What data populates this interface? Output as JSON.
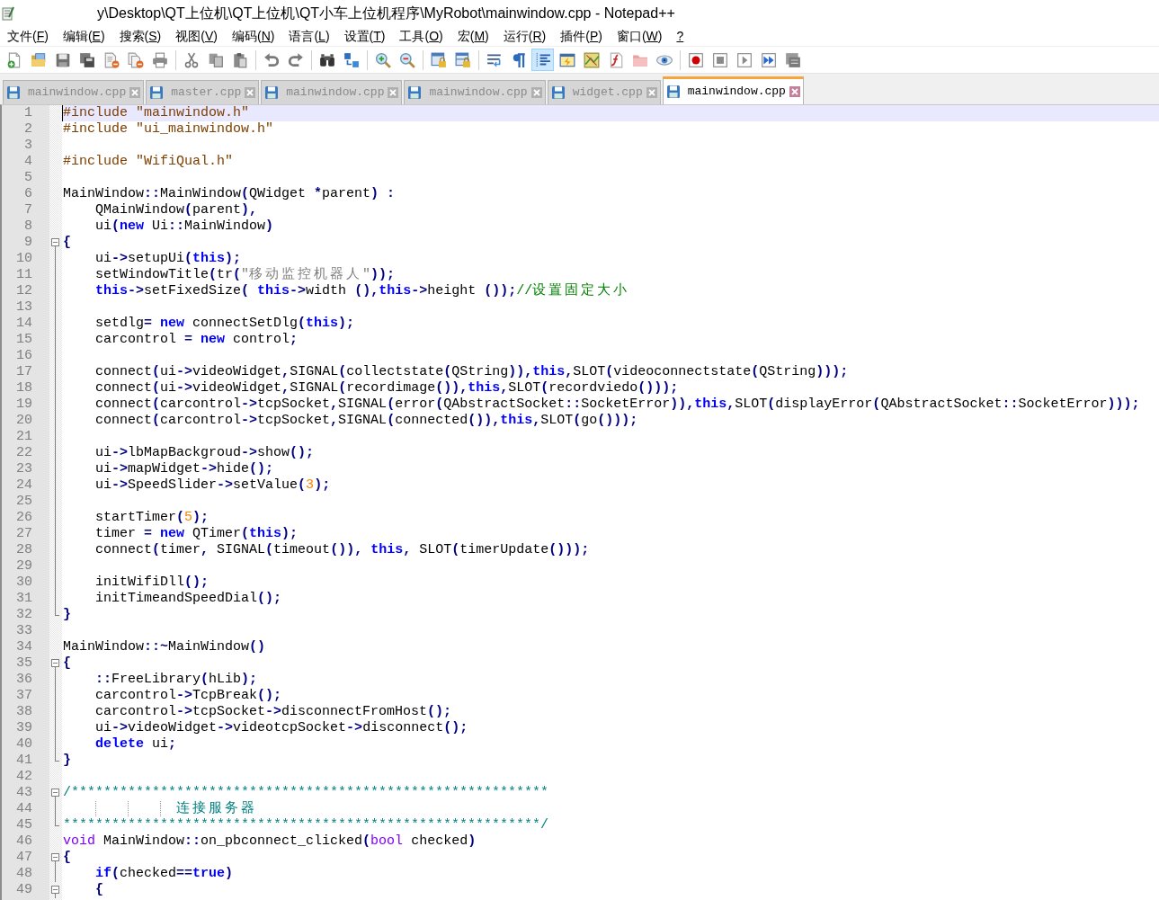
{
  "window": {
    "title": "y\\Desktop\\QT上位机\\QT上位机\\QT小车上位机程序\\MyRobot\\mainwindow.cpp - Notepad++"
  },
  "menu": [
    {
      "label": "文件(F)"
    },
    {
      "label": "编辑(E)"
    },
    {
      "label": "搜索(S)"
    },
    {
      "label": "视图(V)"
    },
    {
      "label": "编码(N)"
    },
    {
      "label": "语言(L)"
    },
    {
      "label": "设置(T)"
    },
    {
      "label": "工具(O)"
    },
    {
      "label": "宏(M)"
    },
    {
      "label": "运行(R)"
    },
    {
      "label": "插件(P)"
    },
    {
      "label": "窗口(W)"
    },
    {
      "label": "?"
    }
  ],
  "toolbar": {
    "groups": [
      {
        "buttons": [
          {
            "kind": "new",
            "on": false
          },
          {
            "kind": "open",
            "on": false
          },
          {
            "kind": "save",
            "on": false
          },
          {
            "kind": "save-all",
            "on": false
          },
          {
            "kind": "close",
            "on": false
          },
          {
            "kind": "close-all",
            "on": false
          },
          {
            "kind": "print",
            "on": false
          }
        ]
      },
      {
        "buttons": [
          {
            "kind": "cut",
            "on": false
          },
          {
            "kind": "copy",
            "on": false
          },
          {
            "kind": "paste",
            "on": false
          }
        ]
      },
      {
        "buttons": [
          {
            "kind": "undo",
            "on": false
          },
          {
            "kind": "redo",
            "on": false
          }
        ]
      },
      {
        "buttons": [
          {
            "kind": "find",
            "on": false
          },
          {
            "kind": "replace",
            "on": false
          }
        ]
      },
      {
        "buttons": [
          {
            "kind": "zoom-in",
            "on": false
          },
          {
            "kind": "zoom-out",
            "on": false
          }
        ]
      },
      {
        "buttons": [
          {
            "kind": "sync-vertical",
            "on": false
          },
          {
            "kind": "sync-horizontal",
            "on": false
          }
        ]
      },
      {
        "buttons": [
          {
            "kind": "word-wrap",
            "on": false
          },
          {
            "kind": "all-chars",
            "on": false
          },
          {
            "kind": "indent-guide",
            "on": true
          },
          {
            "kind": "user-language",
            "on": false
          },
          {
            "kind": "document-map",
            "on": false
          },
          {
            "kind": "function-list",
            "on": false
          },
          {
            "kind": "folder-workspace",
            "on": false
          },
          {
            "kind": "monitoring",
            "on": false
          }
        ]
      },
      {
        "buttons": [
          {
            "kind": "record",
            "on": false
          },
          {
            "kind": "stop",
            "on": false
          },
          {
            "kind": "play",
            "on": false
          },
          {
            "kind": "play-multiple",
            "on": false
          },
          {
            "kind": "save-macro",
            "on": false
          }
        ]
      }
    ]
  },
  "tabs": [
    {
      "label": "mainwindow.cpp",
      "selected": false,
      "modified": false
    },
    {
      "label": "master.cpp",
      "selected": false,
      "modified": false
    },
    {
      "label": "mainwindow.cpp",
      "selected": false,
      "modified": false
    },
    {
      "label": "mainwindow.cpp",
      "selected": false,
      "modified": false
    },
    {
      "label": "widget.cpp",
      "selected": false,
      "modified": false
    },
    {
      "label": "mainwindow.cpp",
      "selected": true,
      "modified": false
    }
  ],
  "editor": {
    "lines": [
      {
        "number": "1",
        "kind": "plain",
        "current": true,
        "segments": [
          {
            "kind": "preprocessor",
            "text": "#include \"mainwindow.h\""
          }
        ]
      },
      {
        "number": "2",
        "kind": "plain",
        "current": false,
        "segments": [
          {
            "kind": "preprocessor",
            "text": "#include \"ui_mainwindow.h\""
          }
        ]
      },
      {
        "number": "3",
        "kind": "plain",
        "current": false
      },
      {
        "number": "4",
        "kind": "plain",
        "current": false,
        "segments": [
          {
            "kind": "preprocessor",
            "text": "#include \"WifiQual.h\""
          }
        ]
      },
      {
        "number": "5",
        "kind": "plain",
        "current": false
      },
      {
        "number": "6",
        "kind": "plain",
        "current": false,
        "segments": [
          {
            "kind": "plain",
            "text": "MainWindow"
          },
          {
            "kind": "op",
            "text": "::"
          },
          {
            "kind": "plain",
            "text": "MainWindow"
          },
          {
            "kind": "op",
            "text": "("
          },
          {
            "kind": "plain",
            "text": "QWidget "
          },
          {
            "kind": "op",
            "text": "*"
          },
          {
            "kind": "plain",
            "text": "parent"
          },
          {
            "kind": "op",
            "text": ") :"
          }
        ]
      },
      {
        "number": "7",
        "kind": "plain",
        "current": false,
        "segments": [
          {
            "kind": "plain",
            "text": "    QMainWindow"
          },
          {
            "kind": "op",
            "text": "("
          },
          {
            "kind": "plain",
            "text": "parent"
          },
          {
            "kind": "op",
            "text": "),"
          }
        ]
      },
      {
        "number": "8",
        "kind": "plain",
        "current": false,
        "segments": [
          {
            "kind": "plain",
            "text": "    ui"
          },
          {
            "kind": "op",
            "text": "("
          },
          {
            "kind": "keyword",
            "text": "new"
          },
          {
            "kind": "plain",
            "text": " Ui"
          },
          {
            "kind": "op",
            "text": "::"
          },
          {
            "kind": "plain",
            "text": "MainWindow"
          },
          {
            "kind": "op",
            "text": ")"
          }
        ]
      },
      {
        "number": "9",
        "kind": "fold-start",
        "current": false,
        "segments": [
          {
            "kind": "op",
            "text": "{"
          }
        ]
      },
      {
        "number": "10",
        "kind": "fold-inside",
        "current": false,
        "segments": [
          {
            "kind": "plain",
            "text": "    ui"
          },
          {
            "kind": "op",
            "text": "->"
          },
          {
            "kind": "plain",
            "text": "setupUi"
          },
          {
            "kind": "op",
            "text": "("
          },
          {
            "kind": "keyword",
            "text": "this"
          },
          {
            "kind": "op",
            "text": ");"
          }
        ]
      },
      {
        "number": "11",
        "kind": "fold-inside",
        "current": false,
        "segments": [
          {
            "kind": "plain",
            "text": "    setWindowTitle"
          },
          {
            "kind": "op",
            "text": "("
          },
          {
            "kind": "plain",
            "text": "tr"
          },
          {
            "kind": "op",
            "text": "("
          },
          {
            "kind": "string",
            "text": "\"移动监控机器人\""
          },
          {
            "kind": "op",
            "text": "));"
          }
        ]
      },
      {
        "number": "12",
        "kind": "fold-inside",
        "current": false,
        "segments": [
          {
            "kind": "keyword",
            "text": "    this"
          },
          {
            "kind": "op",
            "text": "->"
          },
          {
            "kind": "plain",
            "text": "setFixedSize"
          },
          {
            "kind": "op",
            "text": "( "
          },
          {
            "kind": "keyword",
            "text": "this"
          },
          {
            "kind": "op",
            "text": "->"
          },
          {
            "kind": "plain",
            "text": "width "
          },
          {
            "kind": "op",
            "text": "(),"
          },
          {
            "kind": "keyword",
            "text": "this"
          },
          {
            "kind": "op",
            "text": "->"
          },
          {
            "kind": "plain",
            "text": "height "
          },
          {
            "kind": "op",
            "text": "());"
          },
          {
            "kind": "comment",
            "text": "//设置固定大小"
          }
        ]
      },
      {
        "number": "13",
        "kind": "fold-inside",
        "current": false
      },
      {
        "number": "14",
        "kind": "fold-inside",
        "current": false,
        "segments": [
          {
            "kind": "plain",
            "text": "    setdlg"
          },
          {
            "kind": "op",
            "text": "= "
          },
          {
            "kind": "keyword",
            "text": "new"
          },
          {
            "kind": "plain",
            "text": " connectSetDlg"
          },
          {
            "kind": "op",
            "text": "("
          },
          {
            "kind": "keyword",
            "text": "this"
          },
          {
            "kind": "op",
            "text": ");"
          }
        ]
      },
      {
        "number": "15",
        "kind": "fold-inside",
        "current": false,
        "segments": [
          {
            "kind": "plain",
            "text": "    carcontrol "
          },
          {
            "kind": "op",
            "text": "= "
          },
          {
            "kind": "keyword",
            "text": "new"
          },
          {
            "kind": "plain",
            "text": " control"
          },
          {
            "kind": "op",
            "text": ";"
          }
        ]
      },
      {
        "number": "16",
        "kind": "fold-inside",
        "current": false
      },
      {
        "number": "17",
        "kind": "fold-inside",
        "current": false,
        "segments": [
          {
            "kind": "plain",
            "text": "    connect"
          },
          {
            "kind": "op",
            "text": "("
          },
          {
            "kind": "plain",
            "text": "ui"
          },
          {
            "kind": "op",
            "text": "->"
          },
          {
            "kind": "plain",
            "text": "videoWidget"
          },
          {
            "kind": "op",
            "text": ","
          },
          {
            "kind": "plain",
            "text": "SIGNAL"
          },
          {
            "kind": "op",
            "text": "("
          },
          {
            "kind": "plain",
            "text": "collectstate"
          },
          {
            "kind": "op",
            "text": "("
          },
          {
            "kind": "plain",
            "text": "QString"
          },
          {
            "kind": "op",
            "text": ")),"
          },
          {
            "kind": "keyword",
            "text": "this"
          },
          {
            "kind": "op",
            "text": ","
          },
          {
            "kind": "plain",
            "text": "SLOT"
          },
          {
            "kind": "op",
            "text": "("
          },
          {
            "kind": "plain",
            "text": "videoconnectstate"
          },
          {
            "kind": "op",
            "text": "("
          },
          {
            "kind": "plain",
            "text": "QString"
          },
          {
            "kind": "op",
            "text": ")));"
          }
        ]
      },
      {
        "number": "18",
        "kind": "fold-inside",
        "current": false,
        "segments": [
          {
            "kind": "plain",
            "text": "    connect"
          },
          {
            "kind": "op",
            "text": "("
          },
          {
            "kind": "plain",
            "text": "ui"
          },
          {
            "kind": "op",
            "text": "->"
          },
          {
            "kind": "plain",
            "text": "videoWidget"
          },
          {
            "kind": "op",
            "text": ","
          },
          {
            "kind": "plain",
            "text": "SIGNAL"
          },
          {
            "kind": "op",
            "text": "("
          },
          {
            "kind": "plain",
            "text": "recordimage"
          },
          {
            "kind": "op",
            "text": "()),"
          },
          {
            "kind": "keyword",
            "text": "this"
          },
          {
            "kind": "op",
            "text": ","
          },
          {
            "kind": "plain",
            "text": "SLOT"
          },
          {
            "kind": "op",
            "text": "("
          },
          {
            "kind": "plain",
            "text": "recordviedo"
          },
          {
            "kind": "op",
            "text": "()));"
          }
        ]
      },
      {
        "number": "19",
        "kind": "fold-inside",
        "current": false,
        "segments": [
          {
            "kind": "plain",
            "text": "    connect"
          },
          {
            "kind": "op",
            "text": "("
          },
          {
            "kind": "plain",
            "text": "carcontrol"
          },
          {
            "kind": "op",
            "text": "->"
          },
          {
            "kind": "plain",
            "text": "tcpSocket"
          },
          {
            "kind": "op",
            "text": ","
          },
          {
            "kind": "plain",
            "text": "SIGNAL"
          },
          {
            "kind": "op",
            "text": "("
          },
          {
            "kind": "plain",
            "text": "error"
          },
          {
            "kind": "op",
            "text": "("
          },
          {
            "kind": "plain",
            "text": "QAbstractSocket"
          },
          {
            "kind": "op",
            "text": "::"
          },
          {
            "kind": "plain",
            "text": "SocketError"
          },
          {
            "kind": "op",
            "text": ")),"
          },
          {
            "kind": "keyword",
            "text": "this"
          },
          {
            "kind": "op",
            "text": ","
          },
          {
            "kind": "plain",
            "text": "SLOT"
          },
          {
            "kind": "op",
            "text": "("
          },
          {
            "kind": "plain",
            "text": "displayError"
          },
          {
            "kind": "op",
            "text": "("
          },
          {
            "kind": "plain",
            "text": "QAbstractSocket"
          },
          {
            "kind": "op",
            "text": "::"
          },
          {
            "kind": "plain",
            "text": "SocketError"
          },
          {
            "kind": "op",
            "text": ")));"
          }
        ]
      },
      {
        "number": "20",
        "kind": "fold-inside",
        "current": false,
        "segments": [
          {
            "kind": "plain",
            "text": "    connect"
          },
          {
            "kind": "op",
            "text": "("
          },
          {
            "kind": "plain",
            "text": "carcontrol"
          },
          {
            "kind": "op",
            "text": "->"
          },
          {
            "kind": "plain",
            "text": "tcpSocket"
          },
          {
            "kind": "op",
            "text": ","
          },
          {
            "kind": "plain",
            "text": "SIGNAL"
          },
          {
            "kind": "op",
            "text": "("
          },
          {
            "kind": "plain",
            "text": "connected"
          },
          {
            "kind": "op",
            "text": "()),"
          },
          {
            "kind": "keyword",
            "text": "this"
          },
          {
            "kind": "op",
            "text": ","
          },
          {
            "kind": "plain",
            "text": "SLOT"
          },
          {
            "kind": "op",
            "text": "("
          },
          {
            "kind": "plain",
            "text": "go"
          },
          {
            "kind": "op",
            "text": "()));"
          }
        ]
      },
      {
        "number": "21",
        "kind": "fold-inside",
        "current": false
      },
      {
        "number": "22",
        "kind": "fold-inside",
        "current": false,
        "segments": [
          {
            "kind": "plain",
            "text": "    ui"
          },
          {
            "kind": "op",
            "text": "->"
          },
          {
            "kind": "plain",
            "text": "lbMapBackgroud"
          },
          {
            "kind": "op",
            "text": "->"
          },
          {
            "kind": "plain",
            "text": "show"
          },
          {
            "kind": "op",
            "text": "();"
          }
        ]
      },
      {
        "number": "23",
        "kind": "fold-inside",
        "current": false,
        "segments": [
          {
            "kind": "plain",
            "text": "    ui"
          },
          {
            "kind": "op",
            "text": "->"
          },
          {
            "kind": "plain",
            "text": "mapWidget"
          },
          {
            "kind": "op",
            "text": "->"
          },
          {
            "kind": "plain",
            "text": "hide"
          },
          {
            "kind": "op",
            "text": "();"
          }
        ]
      },
      {
        "number": "24",
        "kind": "fold-inside",
        "current": false,
        "segments": [
          {
            "kind": "plain",
            "text": "    ui"
          },
          {
            "kind": "op",
            "text": "->"
          },
          {
            "kind": "plain",
            "text": "SpeedSlider"
          },
          {
            "kind": "op",
            "text": "->"
          },
          {
            "kind": "plain",
            "text": "setValue"
          },
          {
            "kind": "op",
            "text": "("
          },
          {
            "kind": "number",
            "text": "3"
          },
          {
            "kind": "op",
            "text": ");"
          }
        ]
      },
      {
        "number": "25",
        "kind": "fold-inside",
        "current": false
      },
      {
        "number": "26",
        "kind": "fold-inside",
        "current": false,
        "segments": [
          {
            "kind": "plain",
            "text": "    startTimer"
          },
          {
            "kind": "op",
            "text": "("
          },
          {
            "kind": "number",
            "text": "5"
          },
          {
            "kind": "op",
            "text": ");"
          }
        ]
      },
      {
        "number": "27",
        "kind": "fold-inside",
        "current": false,
        "segments": [
          {
            "kind": "plain",
            "text": "    timer "
          },
          {
            "kind": "op",
            "text": "= "
          },
          {
            "kind": "keyword",
            "text": "new"
          },
          {
            "kind": "plain",
            "text": " QTimer"
          },
          {
            "kind": "op",
            "text": "("
          },
          {
            "kind": "keyword",
            "text": "this"
          },
          {
            "kind": "op",
            "text": ");"
          }
        ]
      },
      {
        "number": "28",
        "kind": "fold-inside",
        "current": false,
        "segments": [
          {
            "kind": "plain",
            "text": "    connect"
          },
          {
            "kind": "op",
            "text": "("
          },
          {
            "kind": "plain",
            "text": "timer"
          },
          {
            "kind": "op",
            "text": ","
          },
          {
            "kind": "plain",
            "text": " SIGNAL"
          },
          {
            "kind": "op",
            "text": "("
          },
          {
            "kind": "plain",
            "text": "timeout"
          },
          {
            "kind": "op",
            "text": "()), "
          },
          {
            "kind": "keyword",
            "text": "this"
          },
          {
            "kind": "op",
            "text": ","
          },
          {
            "kind": "plain",
            "text": " SLOT"
          },
          {
            "kind": "op",
            "text": "("
          },
          {
            "kind": "plain",
            "text": "timerUpdate"
          },
          {
            "kind": "op",
            "text": "()));"
          }
        ]
      },
      {
        "number": "29",
        "kind": "fold-inside",
        "current": false
      },
      {
        "number": "30",
        "kind": "fold-inside",
        "current": false,
        "segments": [
          {
            "kind": "plain",
            "text": "    initWifiDll"
          },
          {
            "kind": "op",
            "text": "();"
          }
        ]
      },
      {
        "number": "31",
        "kind": "fold-inside",
        "current": false,
        "segments": [
          {
            "kind": "plain",
            "text": "    initTimeandSpeedDial"
          },
          {
            "kind": "op",
            "text": "();"
          }
        ]
      },
      {
        "number": "32",
        "kind": "fold-end",
        "current": false,
        "segments": [
          {
            "kind": "op",
            "text": "}"
          }
        ]
      },
      {
        "number": "33",
        "kind": "plain",
        "current": false
      },
      {
        "number": "34",
        "kind": "plain",
        "current": false,
        "segments": [
          {
            "kind": "plain",
            "text": "MainWindow"
          },
          {
            "kind": "op",
            "text": "::~"
          },
          {
            "kind": "plain",
            "text": "MainWindow"
          },
          {
            "kind": "op",
            "text": "()"
          }
        ]
      },
      {
        "number": "35",
        "kind": "fold-start",
        "current": false,
        "segments": [
          {
            "kind": "op",
            "text": "{"
          }
        ]
      },
      {
        "number": "36",
        "kind": "fold-inside",
        "current": false,
        "segments": [
          {
            "kind": "op",
            "text": "    ::"
          },
          {
            "kind": "plain",
            "text": "FreeLibrary"
          },
          {
            "kind": "op",
            "text": "("
          },
          {
            "kind": "plain",
            "text": "hLib"
          },
          {
            "kind": "op",
            "text": ");"
          }
        ]
      },
      {
        "number": "37",
        "kind": "fold-inside",
        "current": false,
        "segments": [
          {
            "kind": "plain",
            "text": "    carcontrol"
          },
          {
            "kind": "op",
            "text": "->"
          },
          {
            "kind": "plain",
            "text": "TcpBreak"
          },
          {
            "kind": "op",
            "text": "();"
          }
        ]
      },
      {
        "number": "38",
        "kind": "fold-inside",
        "current": false,
        "segments": [
          {
            "kind": "plain",
            "text": "    carcontrol"
          },
          {
            "kind": "op",
            "text": "->"
          },
          {
            "kind": "plain",
            "text": "tcpSocket"
          },
          {
            "kind": "op",
            "text": "->"
          },
          {
            "kind": "plain",
            "text": "disconnectFromHost"
          },
          {
            "kind": "op",
            "text": "();"
          }
        ]
      },
      {
        "number": "39",
        "kind": "fold-inside",
        "current": false,
        "segments": [
          {
            "kind": "plain",
            "text": "    ui"
          },
          {
            "kind": "op",
            "text": "->"
          },
          {
            "kind": "plain",
            "text": "videoWidget"
          },
          {
            "kind": "op",
            "text": "->"
          },
          {
            "kind": "plain",
            "text": "videotcpSocket"
          },
          {
            "kind": "op",
            "text": "->"
          },
          {
            "kind": "plain",
            "text": "disconnect"
          },
          {
            "kind": "op",
            "text": "();"
          }
        ]
      },
      {
        "number": "40",
        "kind": "fold-inside",
        "current": false,
        "segments": [
          {
            "kind": "keyword",
            "text": "    delete"
          },
          {
            "kind": "plain",
            "text": " ui"
          },
          {
            "kind": "op",
            "text": ";"
          }
        ]
      },
      {
        "number": "41",
        "kind": "fold-end",
        "current": false,
        "segments": [
          {
            "kind": "op",
            "text": "}"
          }
        ]
      },
      {
        "number": "42",
        "kind": "plain",
        "current": false
      },
      {
        "number": "43",
        "kind": "fold-start",
        "current": false,
        "segments": [
          {
            "kind": "block-comment",
            "text": "/***********************************************************"
          }
        ]
      },
      {
        "number": "44",
        "kind": "fold-inside",
        "current": false,
        "segments": [
          {
            "kind": "indent",
            "guide": false
          },
          {
            "kind": "indent",
            "guide": true
          },
          {
            "kind": "indent",
            "guide": true
          },
          {
            "kind": "block-comment",
            "text": "  连接服务器",
            "guide": true
          }
        ]
      },
      {
        "number": "45",
        "kind": "fold-end",
        "current": false,
        "segments": [
          {
            "kind": "block-comment",
            "text": "***********************************************************/"
          }
        ]
      },
      {
        "number": "46",
        "kind": "plain",
        "current": false,
        "segments": [
          {
            "kind": "type",
            "text": "void"
          },
          {
            "kind": "plain",
            "text": " MainWindow"
          },
          {
            "kind": "op",
            "text": "::"
          },
          {
            "kind": "plain",
            "text": "on_pbconnect_clicked"
          },
          {
            "kind": "op",
            "text": "("
          },
          {
            "kind": "type",
            "text": "bool"
          },
          {
            "kind": "plain",
            "text": " checked"
          },
          {
            "kind": "op",
            "text": ")"
          }
        ]
      },
      {
        "number": "47",
        "kind": "fold-start",
        "current": false,
        "segments": [
          {
            "kind": "op",
            "text": "{"
          }
        ]
      },
      {
        "number": "48",
        "kind": "fold-inside",
        "current": false,
        "segments": [
          {
            "kind": "keyword",
            "text": "    if"
          },
          {
            "kind": "op",
            "text": "("
          },
          {
            "kind": "plain",
            "text": "checked"
          },
          {
            "kind": "op",
            "text": "=="
          },
          {
            "kind": "keyword",
            "text": "true"
          },
          {
            "kind": "op",
            "text": ")"
          }
        ]
      },
      {
        "number": "49",
        "kind": "fold-start",
        "current": false,
        "segments": [
          {
            "kind": "op",
            "text": "    {"
          }
        ]
      }
    ]
  }
}
